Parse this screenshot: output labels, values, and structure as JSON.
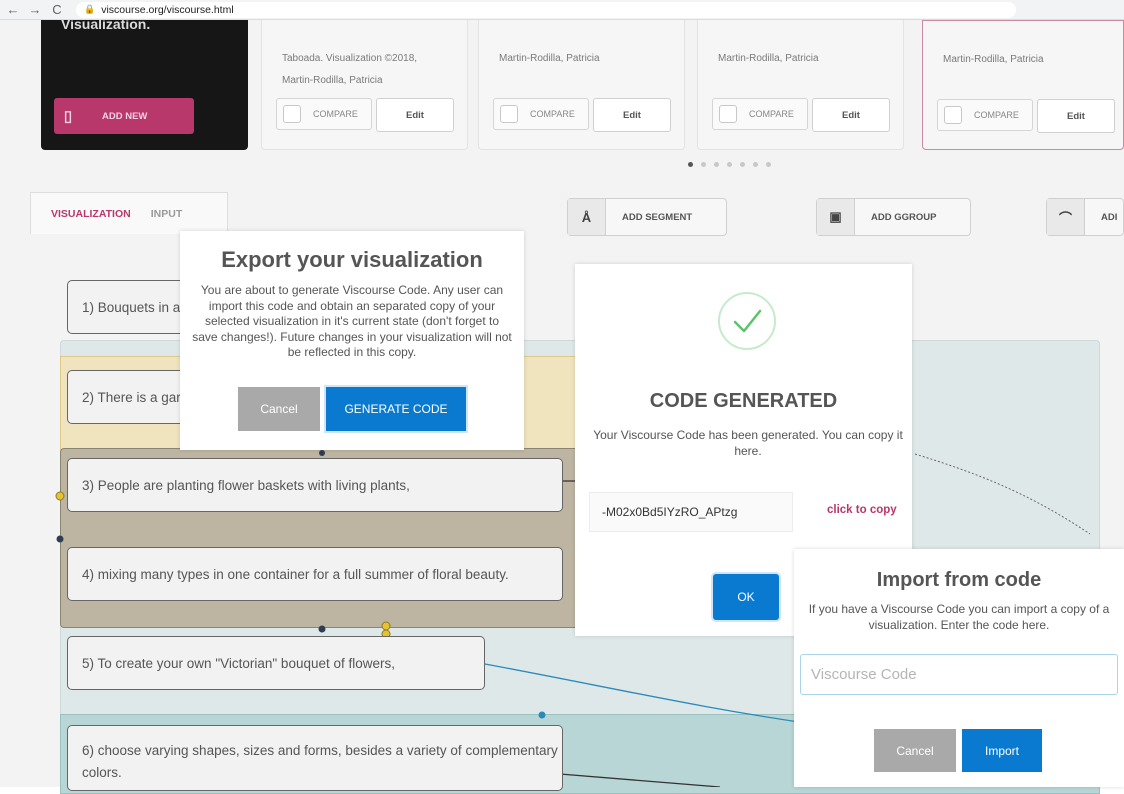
{
  "browser": {
    "back_icon": "←",
    "forward_icon": "→",
    "reload_icon": "C",
    "url": "viscourse.org/viscourse.html"
  },
  "cards": {
    "dark": {
      "title": "Visualization.",
      "add_new_label": "ADD NEW"
    },
    "items": [
      {
        "meta_line1": "Taboada. Visualization ©2018,",
        "meta_line2": "Martin-Rodilla, Patricia",
        "compare_label": "COMPARE",
        "edit_label": "Edit"
      },
      {
        "meta_line1": "Martin-Rodilla, Patricia",
        "meta_line2": "",
        "compare_label": "COMPARE",
        "edit_label": "Edit"
      },
      {
        "meta_line1": "Martin-Rodilla, Patricia",
        "meta_line2": "",
        "compare_label": "COMPARE",
        "edit_label": "Edit"
      },
      {
        "meta_line1": "Martin-Rodilla, Patricia",
        "meta_line2": "",
        "compare_label": "COMPARE",
        "edit_label": "Edit"
      }
    ]
  },
  "tabs": {
    "visualization": "VISUALIZATION",
    "input": "INPUT"
  },
  "toolbar": {
    "add_segment": "ADD SEGMENT",
    "add_group": "ADD GGROUP",
    "add_relation": "ADI"
  },
  "segments": [
    "1) Bouquets in a",
    "2) There is a gar",
    "3) People are planting flower baskets with living plants,",
    "4) mixing many types in one container for a full summer of floral beauty.",
    "5) To create your own \"Victorian\" bouquet of flowers,",
    "6) choose varying shapes, sizes and forms, besides a variety of complementary colors."
  ],
  "export_modal": {
    "title": "Export your visualization",
    "text": "You are about to generate Viscourse Code. Any user can import this code and obtain an separated copy of your selected visualization in it's current state (don't forget to save changes!). Future changes in your visualization will not be reflected in this copy.",
    "cancel_label": "Cancel",
    "generate_label": "GENERATE CODE"
  },
  "code_modal": {
    "title": "CODE GENERATED",
    "text": "Your Viscourse Code has been generated. You can copy it here.",
    "code": "-M02x0Bd5IYzRO_APtzg",
    "copy_label": "click to copy",
    "ok_label": "OK"
  },
  "import_modal": {
    "title": "Import from code",
    "text": "If you have a Viscourse Code you can import a copy of a visualization. Enter the code here.",
    "placeholder": "Viscourse Code",
    "cancel_label": "Cancel",
    "import_label": "Import"
  },
  "colors": {
    "accent": "#b8386b",
    "primary_button": "#0a7ad0",
    "cancel_button": "#a9a9a9",
    "success": "#5cc46a",
    "group_yellow": "#f5e6b5",
    "group_teal": "#d9eaea"
  }
}
